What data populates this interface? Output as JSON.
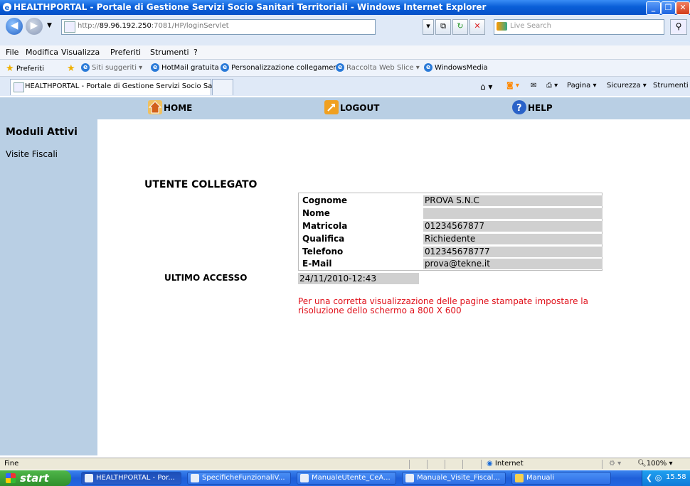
{
  "window": {
    "title": "HEALTHPORTAL - Portale di Gestione Servizi Socio Sanitari Territoriali - Windows Internet Explorer"
  },
  "address_bar": {
    "url_prefix": "http://",
    "url_host": "89.96.192.250",
    "url_rest": ":7081/HP/loginServlet",
    "search_placeholder": "Live Search"
  },
  "menu": [
    "File",
    "Modifica",
    "Visualizza",
    "Preferiti",
    "Strumenti",
    "?"
  ],
  "favorites": {
    "label": "Preferiti",
    "items": [
      "Siti suggeriti ▾",
      "HotMail gratuita",
      "Personalizzazione collegamenti",
      "Raccolta Web Slice ▾",
      "WindowsMedia"
    ]
  },
  "tab": {
    "label": "HEALTHPORTAL - Portale di Gestione Servizi Socio Sa..."
  },
  "command_bar": {
    "pagina": "Pagina ▾",
    "sicurezza": "Sicurezza ▾",
    "strumenti": "Strumenti ▾"
  },
  "page_nav": {
    "home": "HOME",
    "logout": "LOGOUT",
    "help": "HELP"
  },
  "sidebar": {
    "heading": "Moduli Attivi",
    "items": [
      "Visite Fiscali"
    ]
  },
  "main": {
    "title": "UTENTE COLLEGATO",
    "fields": [
      {
        "label": "Cognome",
        "value": "PROVA S.N.C"
      },
      {
        "label": "Nome",
        "value": ""
      },
      {
        "label": "Matricola",
        "value": "01234567877"
      },
      {
        "label": "Qualifica",
        "value": "Richiedente"
      },
      {
        "label": "Telefono",
        "value": "012345678777"
      },
      {
        "label": "E-Mail",
        "value": "prova@tekne.it"
      }
    ],
    "ultimo_accesso_label": "ULTIMO ACCESSO",
    "ultimo_accesso_value": "24/11/2010-12:43",
    "note": "Per una corretta visualizzazione delle pagine stampate impostare la risoluzione dello schermo a 800 X 600"
  },
  "status_bar": {
    "status": "Fine",
    "zone": "Internet",
    "zoom": "100%"
  },
  "taskbar": {
    "start": "start",
    "tasks": [
      "HEALTHPORTAL - Por...",
      "SpecificheFunzionaliV...",
      "ManualeUtente_CeA...",
      "Manuale_Visite_Fiscal...",
      "Manuali"
    ],
    "clock": "15.58"
  }
}
